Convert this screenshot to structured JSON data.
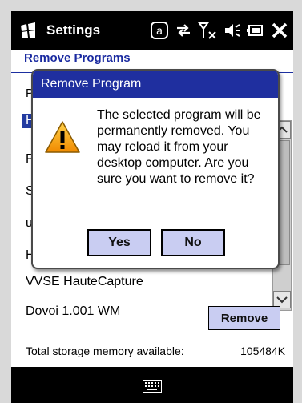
{
  "titlebar": {
    "app_title": "Settings",
    "icons": [
      "windows-logo-icon",
      "notification-icon",
      "sync-icon",
      "signal-icon",
      "volume-icon",
      "battery-icon",
      "close-icon"
    ]
  },
  "page": {
    "header": "Remove Programs",
    "list_header": "Pr",
    "list_items": [
      {
        "label": "H",
        "selected": true
      },
      {
        "label": "P",
        "selected": false
      },
      {
        "label": "S",
        "selected": false
      },
      {
        "label": "u",
        "selected": false
      },
      {
        "label": "H",
        "selected": false
      },
      {
        "label": "VVSE HauteCapture",
        "selected": false
      },
      {
        "label": "Dovoi 1.001 WM",
        "selected": false
      }
    ],
    "remove_label": "Remove",
    "storage_label": "Total storage memory available:",
    "storage_value": "105484K"
  },
  "dialog": {
    "title": "Remove Program",
    "message": "The selected program will be permanently removed. You may reload it from your desktop computer. Are you sure you want to remove it?",
    "yes_label": "Yes",
    "no_label": "No"
  },
  "colors": {
    "accent": "#1f2f9f",
    "button_fill": "#c9cdf2",
    "header_text": "#1a2aa0"
  }
}
